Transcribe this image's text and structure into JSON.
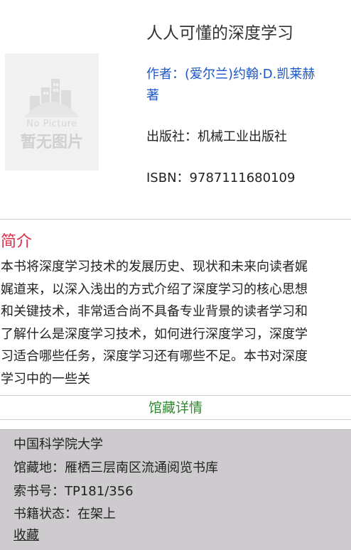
{
  "book": {
    "title": "人人可懂的深度学习",
    "author_line1": "作者：(爱尔兰)约翰·D.凯莱赫",
    "author_line2": "著",
    "publisher": "出版社：机械工业出版社",
    "isbn": "ISBN：9787111680109",
    "cover": {
      "no_picture_en": "No Picture",
      "no_picture_cn": "暂无图片"
    }
  },
  "intro": {
    "heading": "简介",
    "lines": [
      "本书将深度学习技术的发展历史、现状和未来向读者娓",
      "娓道来，以深入浅出的方式介绍了深度学习的核心思想",
      "和关键技术，非常适合尚不具备专业背景的读者学习和",
      "了解什么是深度学习技术，如何进行深度学习，深度学",
      "习适合哪些任务，深度学习还有哪些不足。本书对深度",
      "学习中的一些关"
    ]
  },
  "holdings": {
    "link_label": "馆藏详情",
    "library": "中国科学院大学",
    "location": "馆藏地：雁栖三层南区流通阅览书库",
    "call_number": "索书号：TP181/356",
    "status": "书籍状态：在架上",
    "favorite_label": "收藏"
  },
  "colors": {
    "author": "#1a56c8",
    "intro_heading": "#d9304a",
    "holdings_link": "#2e8b2e",
    "panel_bg": "#cdcbcd",
    "favorite_link": "#1a3fd6"
  }
}
